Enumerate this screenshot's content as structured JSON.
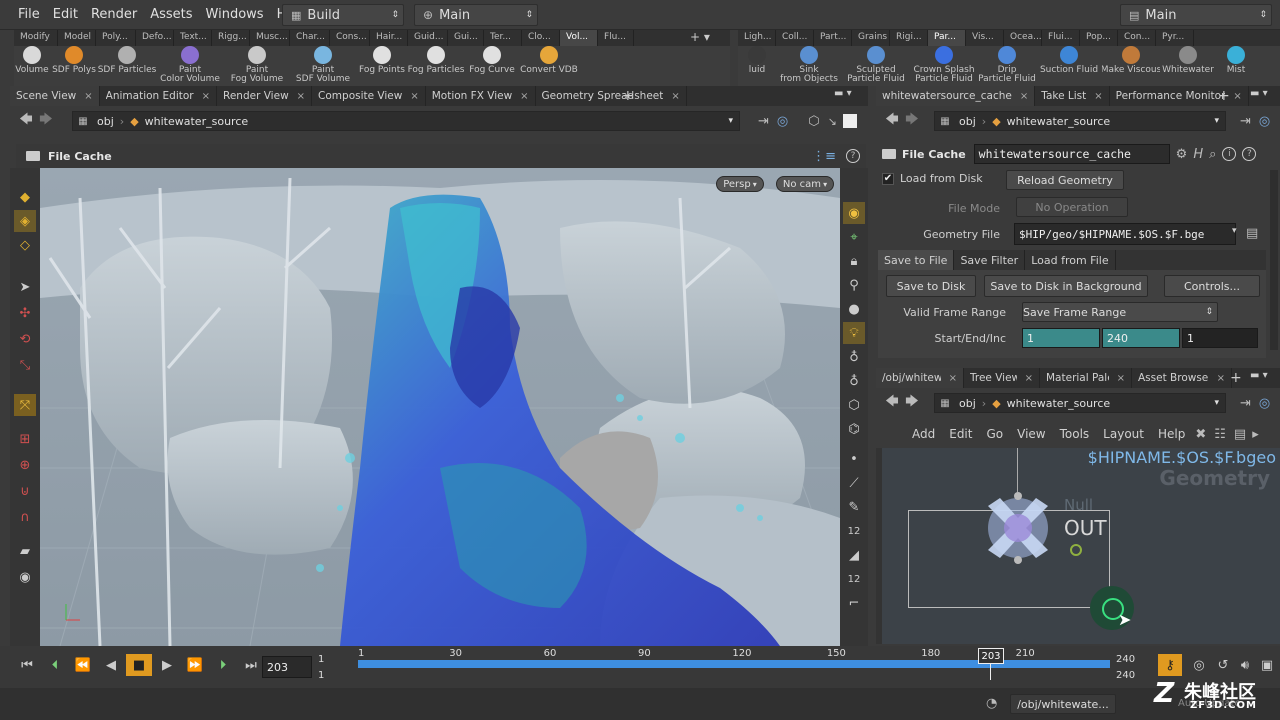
{
  "menubar": {
    "items": [
      "File",
      "Edit",
      "Render",
      "Assets",
      "Windows",
      "Help"
    ],
    "desktop": "Build",
    "context": "Main",
    "right_context": "Main"
  },
  "shelf_tabs_left": [
    "Modify",
    "Model",
    "Poly...",
    "Defo...",
    "Text...",
    "Rigg...",
    "Musc...",
    "Char...",
    "Cons...",
    "Hair...",
    "Guid...",
    "Gui...",
    "Ter...",
    "Clo...",
    "Vol...",
    "Flu..."
  ],
  "shelf_tabs_right": [
    "Ligh...",
    "Coll...",
    "Part...",
    "Grains",
    "Rigi...",
    "Par...",
    "Vis...",
    "Ocea...",
    "Flui...",
    "Pop...",
    "Con...",
    "Pyr..."
  ],
  "shelf_tools_left": [
    {
      "label": "Volume",
      "color": "#d9d9d9"
    },
    {
      "label": "SDF Polys",
      "color": "#e08a2a"
    },
    {
      "label": "SDF Particles",
      "color": "#b0b0b0"
    },
    {
      "label": "Paint\nColor Volume",
      "color": "#8a6fd0"
    },
    {
      "label": "Paint\nFog Volume",
      "color": "#c9c9c9"
    },
    {
      "label": "Paint\nSDF Volume",
      "color": "#79b6e0"
    },
    {
      "label": "Fog Points",
      "color": "#e0e0e0"
    },
    {
      "label": "Fog Particles",
      "color": "#e0e0e0"
    },
    {
      "label": "Fog Curve",
      "color": "#e0e0e0"
    },
    {
      "label": "Convert VDB",
      "color": "#e6a63a"
    }
  ],
  "shelf_tools_right": [
    {
      "label": "luid",
      "color": "#3a3a3a"
    },
    {
      "label": "Sink\nfrom Objects",
      "color": "#5a8fd0"
    },
    {
      "label": "Sculpted\nParticle Fluid",
      "color": "#5a8fd0"
    },
    {
      "label": "Crown Splash\nParticle Fluid",
      "color": "#3b6fe0"
    },
    {
      "label": "Drip\nParticle Fluid",
      "color": "#4f88d8"
    },
    {
      "label": "Suction Fluid",
      "color": "#3e86d6"
    },
    {
      "label": "Make Viscous",
      "color": "#c07a3a"
    },
    {
      "label": "Whitewater",
      "color": "#8a8a8a"
    },
    {
      "label": "Mist",
      "color": "#3ab0d8"
    }
  ],
  "left_panel": {
    "tabs": [
      "Scene View",
      "Animation Editor",
      "Render View",
      "Composite View",
      "Motion FX View",
      "Geometry Spreadsheet"
    ],
    "path_root": "obj",
    "path_node": "whitewater_source",
    "viewer_title": "File Cache",
    "persp": "Persp",
    "cam": "No cam"
  },
  "param_panel": {
    "tabs": [
      "whitewatersource_cache",
      "Take List",
      "Performance Monitor"
    ],
    "path_root": "obj",
    "path_node": "whitewater_source",
    "node_type": "File Cache",
    "node_name": "whitewatersource_cache",
    "load_from_disk": "Load from Disk",
    "reload": "Reload Geometry",
    "file_mode_label": "File Mode",
    "file_mode": "No Operation",
    "geo_file_label": "Geometry File",
    "geo_file": "$HIP/geo/$HIPNAME.$OS.$F.bge",
    "subtabs": [
      "Save to File",
      "Save Filter",
      "Load from File"
    ],
    "save_to_disk": "Save to Disk",
    "save_bg": "Save to Disk in Background",
    "controls": "Controls...",
    "valid_range_label": "Valid Frame Range",
    "valid_range": "Save Frame Range",
    "start_end_label": "Start/End/Inc",
    "start": "1",
    "end": "240",
    "inc": "1"
  },
  "network_panel": {
    "tabs": [
      "/obj/whitew...",
      "Tree View",
      "Material Pale...",
      "Asset Browser"
    ],
    "path_root": "obj",
    "path_node": "whitewater_source",
    "menu": [
      "Add",
      "Edit",
      "Go",
      "View",
      "Tools",
      "Layout",
      "Help"
    ],
    "overlay_path": "$HIPNAME.$OS.$F.bgeo",
    "overlay_type": "Geometry",
    "node_type": "Null",
    "node_name": "OUT"
  },
  "timeline": {
    "current_frame": "203",
    "start": "1",
    "start2": "1",
    "ticks": [
      "1",
      "30",
      "60",
      "90",
      "120",
      "150",
      "180",
      "210"
    ],
    "marker": "203",
    "end": "240",
    "end2": "240",
    "range_fraction": 1.0
  },
  "statusbar": {
    "path": "/obj/whitewate...",
    "auto": "Auto Update"
  },
  "watermark": {
    "text": "朱峰社区",
    "sub": "ZF3D.COM"
  }
}
